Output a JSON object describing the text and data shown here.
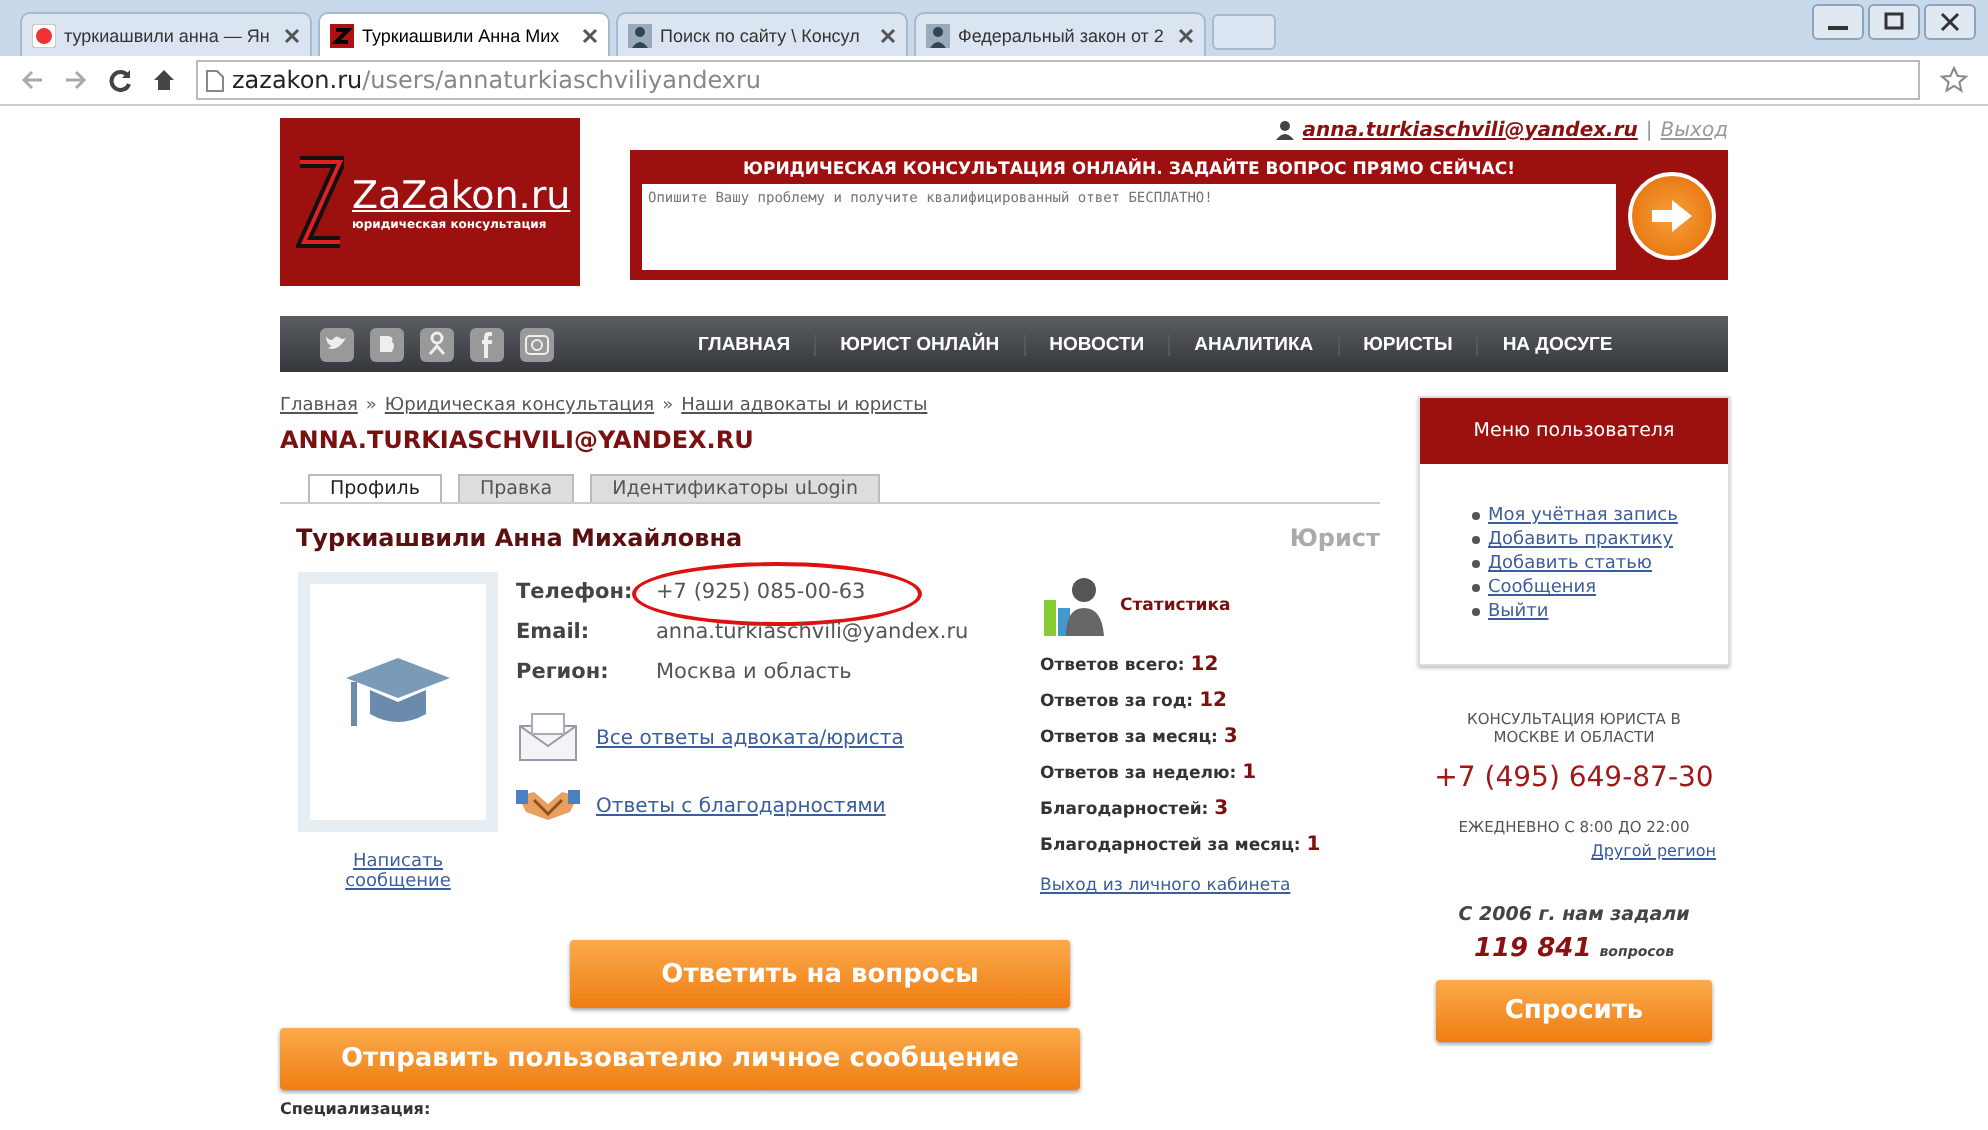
{
  "browser": {
    "tabs": [
      {
        "title": "туркиашвили анна — Ян",
        "kind": "search",
        "selected": false
      },
      {
        "title": "Туркиашвили Анна Мих",
        "kind": "site",
        "selected": true
      },
      {
        "title": "Поиск по сайту \\ Консул",
        "kind": "person",
        "selected": false
      },
      {
        "title": "Федеральный закон от 2",
        "kind": "person",
        "selected": false
      }
    ],
    "url_host": "zazakon.ru",
    "url_path": "/users/annaturkiaschviliyandexru"
  },
  "header": {
    "user_link": "anna.turkiaschvili@yandex.ru",
    "separator": "|",
    "logout": "Выход",
    "logo_name": "ZaZakon.ru",
    "logo_tagline": "юридическая консультация",
    "question_title": "ЮРИДИЧЕСКАЯ КОНСУЛЬТАЦИЯ ОНЛАЙН. ЗАДАЙТЕ ВОПРОС ПРЯМО СЕЙЧАС!",
    "question_placeholder": "Опишите Вашу проблему и получите квалифицированный ответ БЕСПЛАТНО!"
  },
  "social": [
    {
      "kind": "twitter"
    },
    {
      "kind": "vk"
    },
    {
      "kind": "ok"
    },
    {
      "kind": "facebook"
    },
    {
      "kind": "camera"
    }
  ],
  "nav": [
    "ГЛАВНАЯ",
    "ЮРИСТ ОНЛАЙН",
    "НОВОСТИ",
    "АНАЛИТИКА",
    "ЮРИСТЫ",
    "НА ДОСУГЕ"
  ],
  "breadcrumbs": [
    "Главная",
    "Юридическая консультация",
    "Наши адвокаты и юристы"
  ],
  "breadcrumb_separator": "»",
  "page_title": "ANNA.TURKIASCHVILI@YANDEX.RU",
  "profile_tabs": [
    {
      "label": "Профиль",
      "selected": true
    },
    {
      "label": "Правка",
      "selected": false
    },
    {
      "label": "Идентификаторы uLogin",
      "selected": false
    }
  ],
  "profile": {
    "full_name": "Туркиашвили Анна Михайловна",
    "role": "Юрист",
    "write_message": "Написать сообщение",
    "fields": [
      {
        "label": "Телефон:",
        "value": "+7 (925) 085-00-63",
        "circled": true
      },
      {
        "label": "Email:",
        "value": "anna.turkiaschvili@yandex.ru",
        "circled": false
      },
      {
        "label": "Регион:",
        "value": "Москва и область",
        "circled": false
      }
    ],
    "links": [
      {
        "kind": "envelope",
        "text": "Все ответы адвоката/юриста"
      },
      {
        "kind": "handshake",
        "text": "Ответы с благодарностями"
      }
    ],
    "stats_title": "Статистика",
    "stats": [
      {
        "label": "Ответов всего:",
        "value": "12"
      },
      {
        "label": "Ответов за год:",
        "value": "12"
      },
      {
        "label": "Ответов за месяц:",
        "value": "3"
      },
      {
        "label": "Ответов за неделю:",
        "value": "1"
      },
      {
        "label": "Благодарностей:",
        "value": "3"
      },
      {
        "label": "Благодарностей за месяц:",
        "value": "1"
      }
    ],
    "cabinet_logout": "Выход из личного кабинета"
  },
  "buttons": {
    "answer": "Ответить на вопросы",
    "send_message": "Отправить пользователю личное сообщение",
    "ask": "Спросить"
  },
  "specialization_label": "Специализация:",
  "sidebar": {
    "menu_title": "Меню пользователя",
    "menu_items": [
      "Моя учётная запись",
      "Добавить практику",
      "Добавить статью",
      "Сообщения",
      "Выйти"
    ],
    "contact_title": "КОНСУЛЬТАЦИЯ ЮРИСТА В МОСКВЕ И ОБЛАСТИ",
    "contact_phone": "+7 (495) 649-87-30",
    "contact_hours": "ЕЖЕДНЕВНО С 8:00 ДО 22:00",
    "other_region": "Другой регион",
    "counter_prefix": "С 2006 г. нам задали",
    "counter_number": "119 841",
    "counter_suffix": "вопросов"
  }
}
